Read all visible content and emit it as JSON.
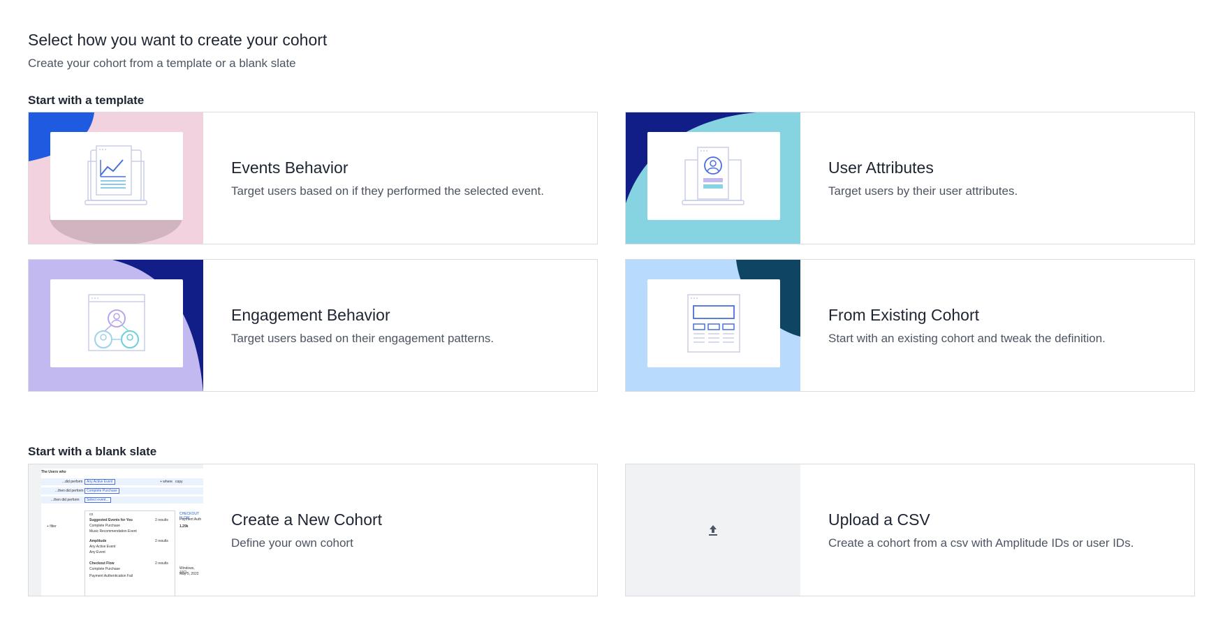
{
  "header": {
    "title": "Select how you want to create your cohort",
    "subtitle": "Create your cohort from a template or a blank slate"
  },
  "sections": {
    "template_label": "Start with a template",
    "blank_label": "Start with a blank slate"
  },
  "cards": {
    "events": {
      "title": "Events Behavior",
      "desc": "Target users based on if they performed the selected event."
    },
    "attributes": {
      "title": "User Attributes",
      "desc": "Target users by their user attributes."
    },
    "engagement": {
      "title": "Engagement Behavior",
      "desc": "Target users based on their engagement patterns."
    },
    "existing": {
      "title": "From Existing Cohort",
      "desc": "Start with an existing cohort and tweak the definition."
    },
    "new": {
      "title": "Create a New Cohort",
      "desc": "Define your own cohort"
    },
    "upload": {
      "title": "Upload a CSV",
      "desc": "Create a cohort from a csv with Amplitude IDs or user IDs."
    }
  },
  "mini_preview": {
    "heading": "The Users who",
    "rows": [
      "...did perform",
      "...then did perform",
      "...then did perform"
    ],
    "chips": [
      "Any Active Event",
      "Complete Purchase",
      "Select event..."
    ],
    "actions": [
      "+ where",
      "copy"
    ],
    "groups": [
      "Suggested Events for You",
      "Amplitude",
      "Checkout Flow"
    ],
    "group_counts": [
      "2 results",
      "2 results",
      "2 results"
    ],
    "items": [
      "Complete Purchase",
      "Music Recommendation Event",
      "Any Active Event",
      "Any Event",
      "Complete Purchase",
      "Payment Authentication Fail"
    ],
    "side_text": [
      "CHECKOUT FLOW",
      "Payment Auth",
      "1.29k",
      "Windows, 10CL",
      "May 5, 2022"
    ],
    "filter_label": "+ filter",
    "search_value": "co"
  },
  "icons": {
    "events": "laptop-chart-icon",
    "attributes": "laptop-user-icon",
    "engagement": "users-network-icon",
    "existing": "document-layout-icon",
    "upload": "upload-icon"
  },
  "colors": {
    "navy": "#121e87",
    "blue": "#1e5be0",
    "pink": "#f2d2de",
    "teal": "#86d4e2",
    "lavender": "#c3b9f1",
    "sky": "#b8dafd",
    "dark_teal": "#0f4563",
    "border": "#d7dbe2"
  }
}
